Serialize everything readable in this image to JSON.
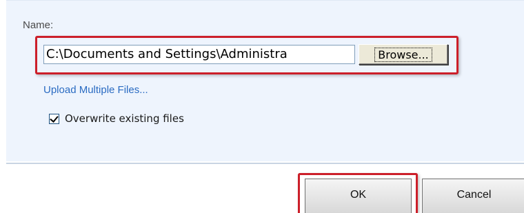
{
  "form": {
    "name_label": "Name:",
    "path_value": "C:\\Documents and Settings\\Administra",
    "browse_label": "Browse...",
    "upload_multiple_label": "Upload Multiple Files...",
    "overwrite_label": "Overwrite existing files",
    "overwrite_checked": true
  },
  "footer": {
    "ok_label": "OK",
    "cancel_label": "Cancel"
  },
  "colors": {
    "panel_background": "#eef4fd",
    "highlight": "#cc1f2a",
    "link": "#2a6bc2"
  }
}
